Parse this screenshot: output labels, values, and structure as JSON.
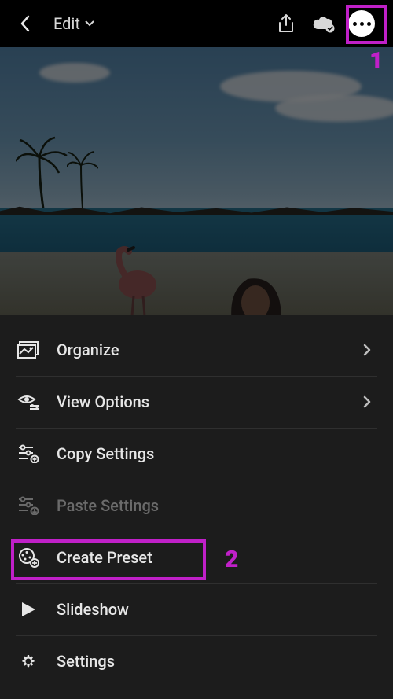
{
  "topbar": {
    "title": "Edit"
  },
  "annotations": {
    "one": "1",
    "two": "2"
  },
  "menu": {
    "items": [
      {
        "key": "organize",
        "label": "Organize",
        "chevron": true,
        "disabled": false
      },
      {
        "key": "view-options",
        "label": "View Options",
        "chevron": true,
        "disabled": false
      },
      {
        "key": "copy-settings",
        "label": "Copy Settings",
        "chevron": false,
        "disabled": false
      },
      {
        "key": "paste-settings",
        "label": "Paste Settings",
        "chevron": false,
        "disabled": true
      },
      {
        "key": "create-preset",
        "label": "Create Preset",
        "chevron": false,
        "disabled": false
      },
      {
        "key": "slideshow",
        "label": "Slideshow",
        "chevron": false,
        "disabled": false
      },
      {
        "key": "settings",
        "label": "Settings",
        "chevron": false,
        "disabled": false
      }
    ]
  }
}
